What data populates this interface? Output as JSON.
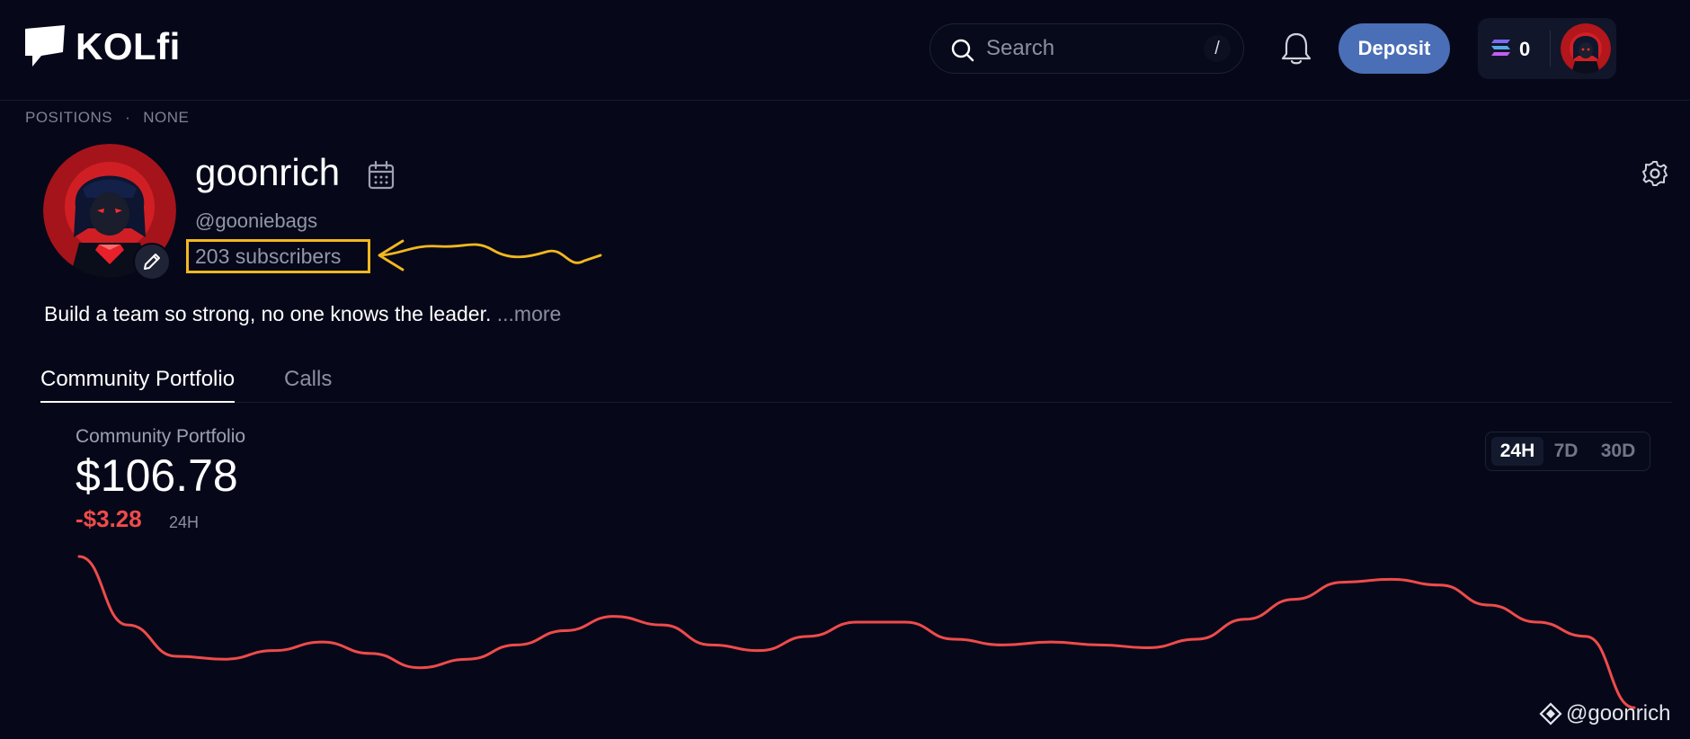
{
  "brand": {
    "name": "KOLfi"
  },
  "header": {
    "search_placeholder": "Search",
    "search_shortcut": "/",
    "deposit_label": "Deposit",
    "wallet_balance": "0"
  },
  "positions": {
    "label": "POSITIONS",
    "separator": "·",
    "value": "NONE"
  },
  "profile": {
    "name": "goonrich",
    "handle": "@gooniebags",
    "subscribers": "203 subscribers",
    "bio": "Build a team so strong, no one knows the leader.",
    "more": "...more"
  },
  "tabs": [
    {
      "label": "Community Portfolio",
      "active": true
    },
    {
      "label": "Calls",
      "active": false
    }
  ],
  "portfolio": {
    "label": "Community Portfolio",
    "value": "$106.78",
    "change": "-$3.28",
    "change_period": "24H",
    "ranges": [
      "24H",
      "7D",
      "30D"
    ],
    "selected_range": "24H"
  },
  "chart_data": {
    "type": "line",
    "title": "",
    "xlabel": "",
    "ylabel": "",
    "grid": false,
    "legend": "none",
    "color": "#ef4b4b",
    "x": [
      0,
      1,
      2,
      3,
      4,
      5,
      6,
      7,
      8,
      9,
      10,
      11,
      12,
      13,
      14,
      15,
      16,
      17,
      18,
      19,
      20,
      21,
      22,
      23,
      24,
      25,
      26,
      27,
      28,
      29,
      30,
      31,
      32
    ],
    "values": [
      112.4,
      110.0,
      108.9,
      108.8,
      109.1,
      109.4,
      109.0,
      108.5,
      108.8,
      109.3,
      109.8,
      110.3,
      110.0,
      109.3,
      109.1,
      109.6,
      110.1,
      110.1,
      109.5,
      109.3,
      109.4,
      109.3,
      109.2,
      109.5,
      110.2,
      110.9,
      111.5,
      111.6,
      111.4,
      110.7,
      110.1,
      109.6,
      107.1
    ],
    "ylim": [
      106,
      113
    ]
  },
  "watermark": {
    "text": "@goonrich"
  },
  "colors": {
    "accent": "#4a6fb7",
    "negative": "#ef4b4b",
    "highlight": "#f3b81f",
    "background": "#060819"
  },
  "icons": {
    "search": "search-icon",
    "bell": "bell-icon",
    "wallet": "solana-icon",
    "calendar": "calendar-icon",
    "edit": "pencil-icon",
    "settings": "gear-icon",
    "watermark": "binance-icon"
  }
}
